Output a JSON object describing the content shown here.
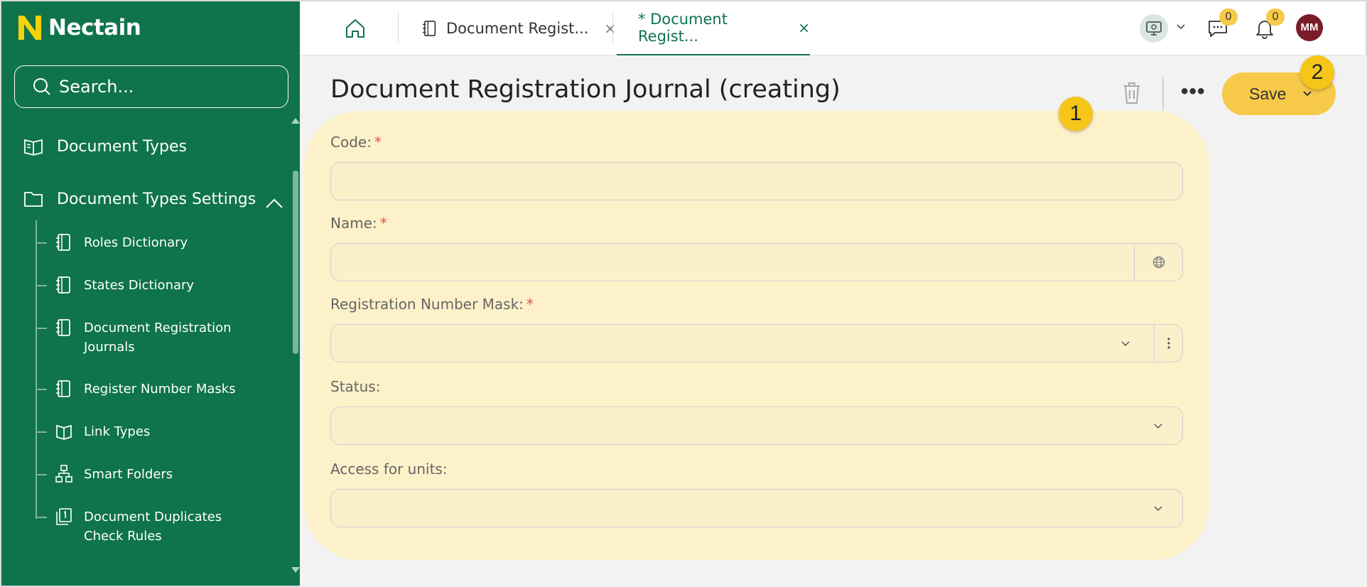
{
  "app": {
    "brand": "Nectain"
  },
  "colors": {
    "sidebar": "#0f734c",
    "accent": "#f7c948",
    "highlight": "#fdf0c7",
    "avatar": "#7a1c2a",
    "required": "#d9534f"
  },
  "sidebar": {
    "search_placeholder": "Search...",
    "items": [
      {
        "label": "Document Types",
        "icon": "book-open-icon"
      },
      {
        "label": "Document Types Settings",
        "icon": "folder-icon",
        "expanded": true
      }
    ],
    "sub_items": [
      {
        "label": "Roles Dictionary",
        "icon": "notebook-icon"
      },
      {
        "label": "States Dictionary",
        "icon": "notebook-icon"
      },
      {
        "label": "Document Registration Journals",
        "icon": "notebook-icon"
      },
      {
        "label": "Register Number Masks",
        "icon": "notebook-icon"
      },
      {
        "label": "Link Types",
        "icon": "book-open-icon"
      },
      {
        "label": "Smart Folders",
        "icon": "hierarchy-icon"
      },
      {
        "label": "Document Duplicates Check Rules",
        "icon": "copy-number-icon"
      }
    ]
  },
  "topbar": {
    "tabs": [
      {
        "label": "Document Regist...",
        "active": false,
        "close": "×"
      },
      {
        "label": "* Document Regist...",
        "active": true,
        "close": "×"
      }
    ],
    "chat_count": "0",
    "notif_count": "0",
    "avatar_initials": "MM"
  },
  "page": {
    "title": "Document Registration Journal (creating)",
    "more_label": "•••",
    "save_label": "Save",
    "callout_1": "1",
    "callout_2": "2"
  },
  "form": {
    "required_mark": "*",
    "code_label": "Code:",
    "name_label": "Name:",
    "mask_label": "Registration Number Mask:",
    "status_label": "Status:",
    "access_label": "Access for units:"
  }
}
